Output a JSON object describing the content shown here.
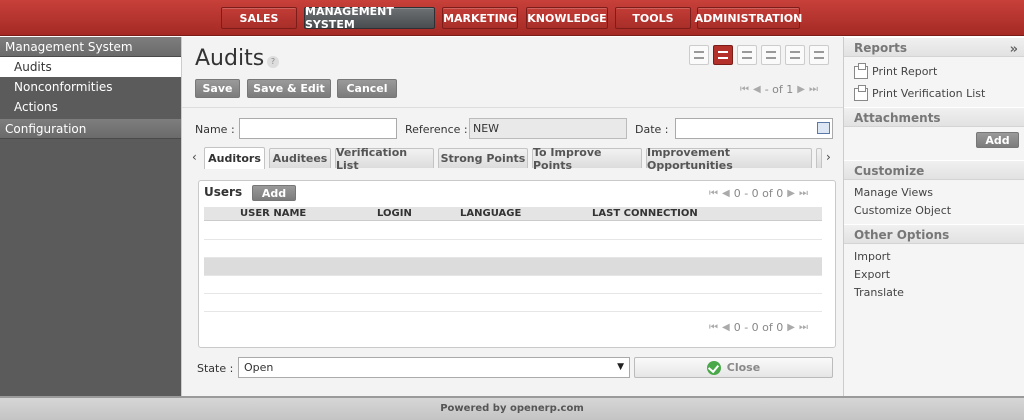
{
  "topmenu": {
    "items": [
      {
        "label": "SALES"
      },
      {
        "label": "MANAGEMENT SYSTEM"
      },
      {
        "label": "MARKETING"
      },
      {
        "label": "KNOWLEDGE"
      },
      {
        "label": "TOOLS"
      },
      {
        "label": "ADMINISTRATION"
      }
    ],
    "active": "MANAGEMENT SYSTEM"
  },
  "sidebar": {
    "sections": [
      {
        "label": "Management System",
        "items": [
          {
            "label": "Audits",
            "selected": true
          },
          {
            "label": "Nonconformities"
          },
          {
            "label": "Actions"
          }
        ]
      },
      {
        "label": "Configuration",
        "items": []
      }
    ]
  },
  "main": {
    "title": "Audits",
    "help_icon": "?",
    "buttons": {
      "save": "Save",
      "save_edit": "Save & Edit",
      "cancel": "Cancel"
    },
    "pager": {
      "text": "- of 1"
    },
    "fields": {
      "name_label": "Name :",
      "name_value": "",
      "reference_label": "Reference :",
      "reference_value": "NEW",
      "date_label": "Date :",
      "date_value": ""
    },
    "tabs": [
      {
        "label": "Auditors",
        "active": true
      },
      {
        "label": "Auditees"
      },
      {
        "label": "Verification List"
      },
      {
        "label": "Strong Points"
      },
      {
        "label": "To Improve Points"
      },
      {
        "label": "Improvement Opportunities"
      }
    ],
    "users_panel": {
      "title": "Users",
      "add_label": "Add",
      "pager_text": "0 - 0 of 0",
      "columns": [
        "USER NAME",
        "LOGIN",
        "LANGUAGE",
        "LAST CONNECTION"
      ],
      "rows": []
    },
    "state": {
      "label": "State :",
      "value": "Open"
    },
    "close_label": "Close"
  },
  "rightbar": {
    "reports": {
      "title": "Reports",
      "items": [
        "Print Report",
        "Print Verification List"
      ]
    },
    "attachments": {
      "title": "Attachments",
      "add_label": "Add"
    },
    "customize": {
      "title": "Customize",
      "items": [
        "Manage Views",
        "Customize Object"
      ]
    },
    "other": {
      "title": "Other Options",
      "items": [
        "Import",
        "Export",
        "Translate"
      ]
    },
    "collapse_symbol": "»"
  },
  "footer": {
    "text": "Powered by openerp.com"
  },
  "icons": [
    "list-view-icon",
    "form-view-icon",
    "graph-view-icon",
    "calendar-view-icon",
    "gantt-view-icon",
    "diagram-view-icon",
    "calendar-icon",
    "print-icon",
    "close-check-icon"
  ],
  "colors": {
    "brand_red": "#b3302b",
    "active_menu": "#5a5d60",
    "sidebar": "#5b5b5b"
  }
}
